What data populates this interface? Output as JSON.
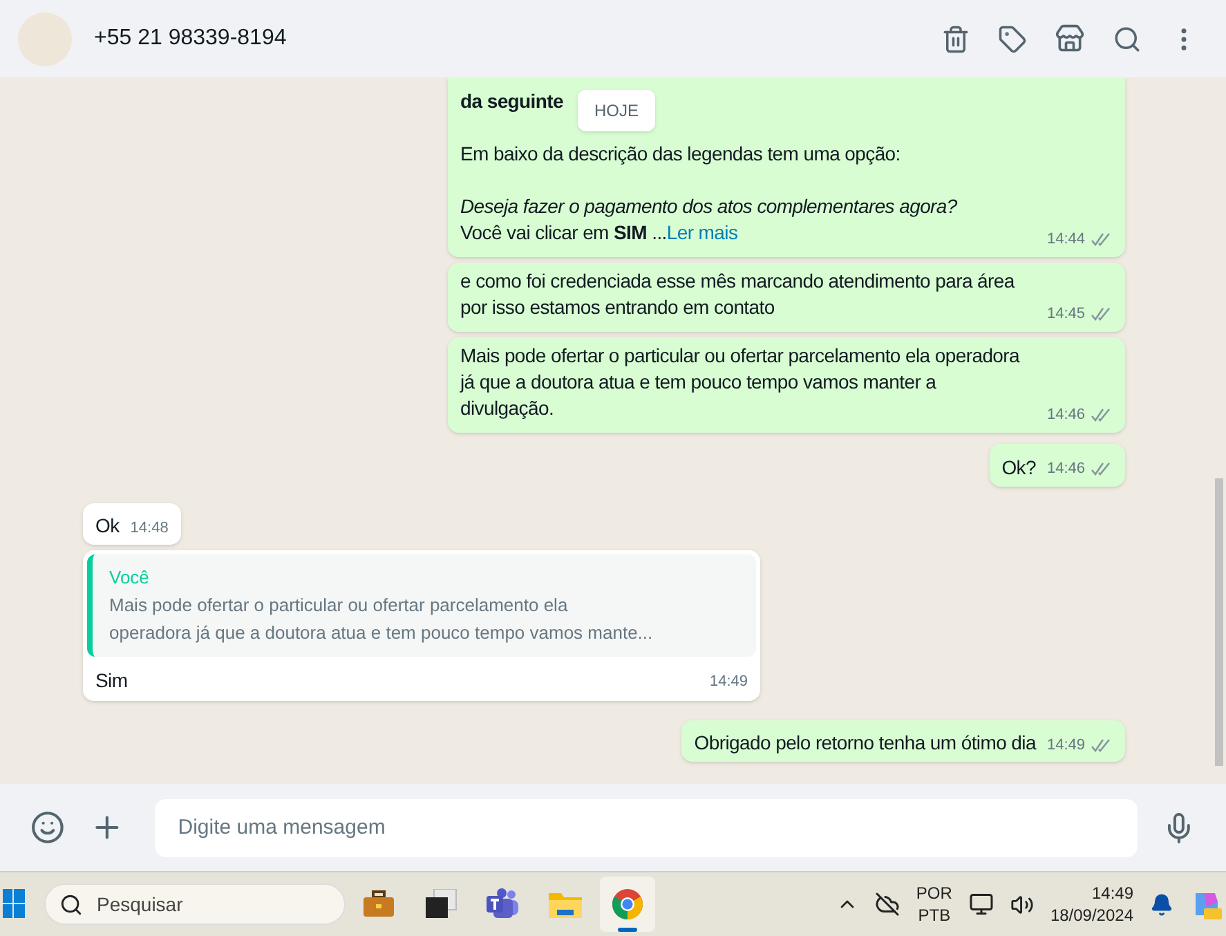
{
  "header": {
    "contact": "+55 21 98339-8194"
  },
  "date_chip": "HOJE",
  "messages": [
    {
      "kind": "out",
      "paragraphs": [
        [
          "**da seguinte**"
        ],
        [
          "Em baixo da descrição das legendas tem uma opção:"
        ],
        [
          "*Deseja fazer o pagamento dos atos complementares agora?*",
          "Você vai clicar em **SIM** ..."
        ]
      ],
      "more": "Ler mais",
      "time": "14:44"
    },
    {
      "kind": "out",
      "paragraphs": [
        [
          "e como foi credenciada esse mês marcando atendimento para área por isso estamos entrando em contato"
        ]
      ],
      "time": "14:45"
    },
    {
      "kind": "out",
      "paragraphs": [
        [
          "Mais pode ofertar o particular ou ofertar parcelamento ela operadora já que a doutora atua e tem pouco tempo vamos manter a divulgação."
        ]
      ],
      "time": "14:46"
    },
    {
      "kind": "out",
      "paragraphs": [
        [
          "Ok?"
        ]
      ],
      "time": "14:46"
    },
    {
      "kind": "in",
      "paragraphs": [
        [
          "Ok"
        ]
      ],
      "time": "14:48"
    },
    {
      "kind": "reply",
      "quote_author": "Você",
      "quote_lines": [
        "Mais pode ofertar o particular ou ofertar parcelamento ela",
        "operadora já que a doutora atua e tem pouco tempo vamos mante..."
      ],
      "paragraphs": [
        [
          "Sim"
        ]
      ],
      "time": "14:49"
    },
    {
      "kind": "out",
      "paragraphs": [
        [
          "Obrigado pelo retorno tenha um ótimo dia"
        ]
      ],
      "time": "14:49"
    }
  ],
  "composer": {
    "placeholder": "Digite uma mensagem"
  },
  "taskbar": {
    "search_placeholder": "Pesquisar",
    "apps": [
      {
        "kind": "work",
        "selected": false
      },
      {
        "kind": "windows",
        "selected": false
      },
      {
        "kind": "teams",
        "selected": false
      },
      {
        "kind": "folder",
        "selected": false
      },
      {
        "kind": "chrome",
        "selected": true
      }
    ],
    "language": [
      "POR",
      "PTB"
    ],
    "time": "14:49",
    "date": "18/09/2024"
  }
}
